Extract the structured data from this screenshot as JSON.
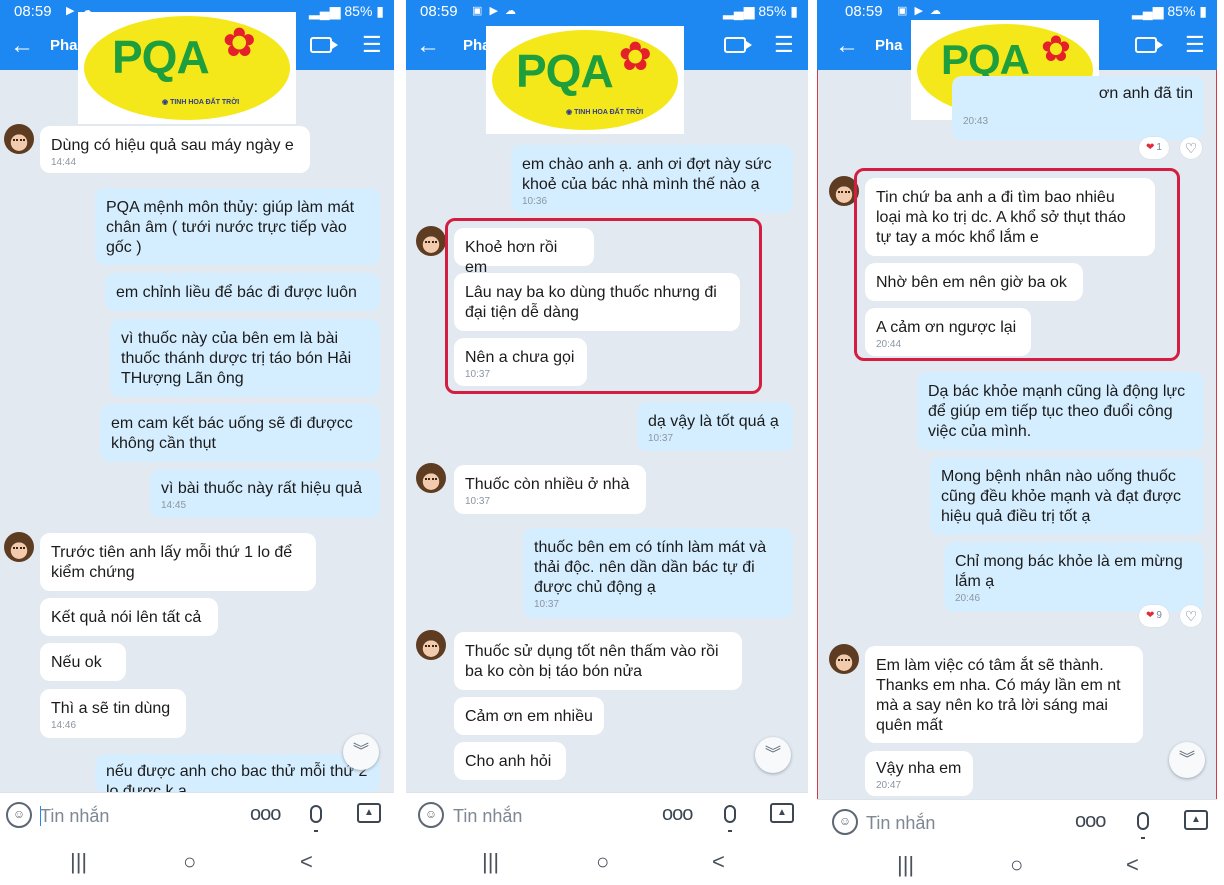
{
  "status_bar": [
    {
      "time": "08:59",
      "battery": "85%"
    },
    {
      "time": "08:59",
      "battery": "85%"
    },
    {
      "time": "08:59",
      "battery": "85%"
    }
  ],
  "header": {
    "contact_name": "Pha",
    "contact_name_visible": "Phan"
  },
  "logo": {
    "wordmark": "PQA",
    "tagline": "TINH HOA ĐẤT TRỜI"
  },
  "composer": {
    "placeholder": "Tin nhắn",
    "more": "ooo"
  },
  "nav": {
    "recents": "|||",
    "home": "○",
    "back": "<"
  },
  "icons": {
    "back": "arrow-left-icon",
    "video": "video-call-icon",
    "menu": "list-menu-icon",
    "sticker": "smiley-icon",
    "mic": "microphone-icon",
    "image": "image-icon",
    "scroll": "double-chevron-down-icon",
    "reaction": "heart-icon"
  },
  "colors": {
    "header_bg": "#1e88f2",
    "outgoing_bubble": "#d5eeff",
    "incoming_bubble": "#ffffff",
    "highlight_box": "#d41e41"
  },
  "screens": [
    {
      "messages": [
        {
          "dir": "in",
          "text": "Dùng có hiệu quả sau máy ngày e",
          "time": "14:44"
        },
        {
          "dir": "out",
          "text": "PQA mệnh môn thủy: giúp làm mát chân âm ( tưới nước trực tiếp vào gốc )"
        },
        {
          "dir": "out",
          "text": "em chỉnh liều để bác đi được luôn"
        },
        {
          "dir": "out",
          "text": "vì thuốc này của bên em là bài thuốc thánh dược trị táo bón Hải THượng Lãn ông"
        },
        {
          "dir": "out",
          "text": "em cam kết bác uống sẽ đi đượcc không cần thụt"
        },
        {
          "dir": "out",
          "text": "vì bài thuốc này rất hiệu quả",
          "time": "14:45"
        },
        {
          "dir": "in",
          "text": "Trước tiên anh lấy mỗi thứ 1 lo để kiểm chứng"
        },
        {
          "dir": "in",
          "text": "Kết quả nói lên tất cả"
        },
        {
          "dir": "in",
          "text": "Nếu ok"
        },
        {
          "dir": "in",
          "text": "Thì a sẽ tin dùng",
          "time": "14:46"
        },
        {
          "dir": "out",
          "text": "nếu được anh cho bac thử mỗi thứ 2 lọ được k a"
        }
      ]
    },
    {
      "messages": [
        {
          "dir": "out",
          "text": "em chào anh ạ. anh ơi đợt này sức khoẻ của bác nhà mình thế nào ạ",
          "time": "10:36"
        },
        {
          "dir": "in",
          "text": "Khoẻ hơn rồi em"
        },
        {
          "dir": "in",
          "text": "Lâu nay ba ko dùng thuốc nhưng đi đại tiện dễ dàng"
        },
        {
          "dir": "in",
          "text": "Nên a chưa gọi",
          "time": "10:37"
        },
        {
          "dir": "out",
          "text": "dạ vậy là tốt quá ạ",
          "time": "10:37"
        },
        {
          "dir": "in",
          "text": "Thuốc còn nhiều ở nhà",
          "time": "10:37"
        },
        {
          "dir": "out",
          "text": "thuốc bên em có tính làm mát và thải độc. nên dần dần bác tự đi được chủ động ạ",
          "time": "10:37"
        },
        {
          "dir": "in",
          "text": "Thuốc sử dụng tốt nên thấm vào rồi ba ko còn bị táo bón nửa"
        },
        {
          "dir": "in",
          "text": "Cảm ơn em nhiều"
        },
        {
          "dir": "in",
          "text": "Cho anh hỏi"
        }
      ]
    },
    {
      "messages": [
        {
          "dir": "out",
          "text": "ơn anh đã tin",
          "time": "20:43"
        },
        {
          "dir": "in",
          "text": "Tin chứ ba anh a đi tìm bao nhiêu loại mà ko trị dc. A khổ sở thụt tháo tự tay a móc khổ lắm e"
        },
        {
          "dir": "in",
          "text": "Nhờ bên em nên giờ ba ok"
        },
        {
          "dir": "in",
          "text": "A cảm ơn ngược lại",
          "time": "20:44"
        },
        {
          "dir": "out",
          "text": "Dạ bác khỏe mạnh cũng là động lực để giúp em tiếp tục theo đuổi công việc của mình."
        },
        {
          "dir": "out",
          "text": "Mong bệnh nhân nào uống thuốc cũng đều khỏe mạnh và đạt được hiệu quả điều trị tốt ạ"
        },
        {
          "dir": "out",
          "text": "Chỉ mong bác khỏe là em mừng lắm ạ",
          "time": "20:46"
        },
        {
          "dir": "in",
          "text": "Em làm việc có tâm ắt sẽ thành. Thanks em nha. Có máy lần em nt mà a say nên ko trả lời sáng mai quên mất"
        },
        {
          "dir": "in",
          "text": "Vậy nha em",
          "time": "20:47"
        }
      ],
      "reactions": [
        {
          "count": "1"
        },
        {
          "count": "9"
        }
      ]
    }
  ]
}
